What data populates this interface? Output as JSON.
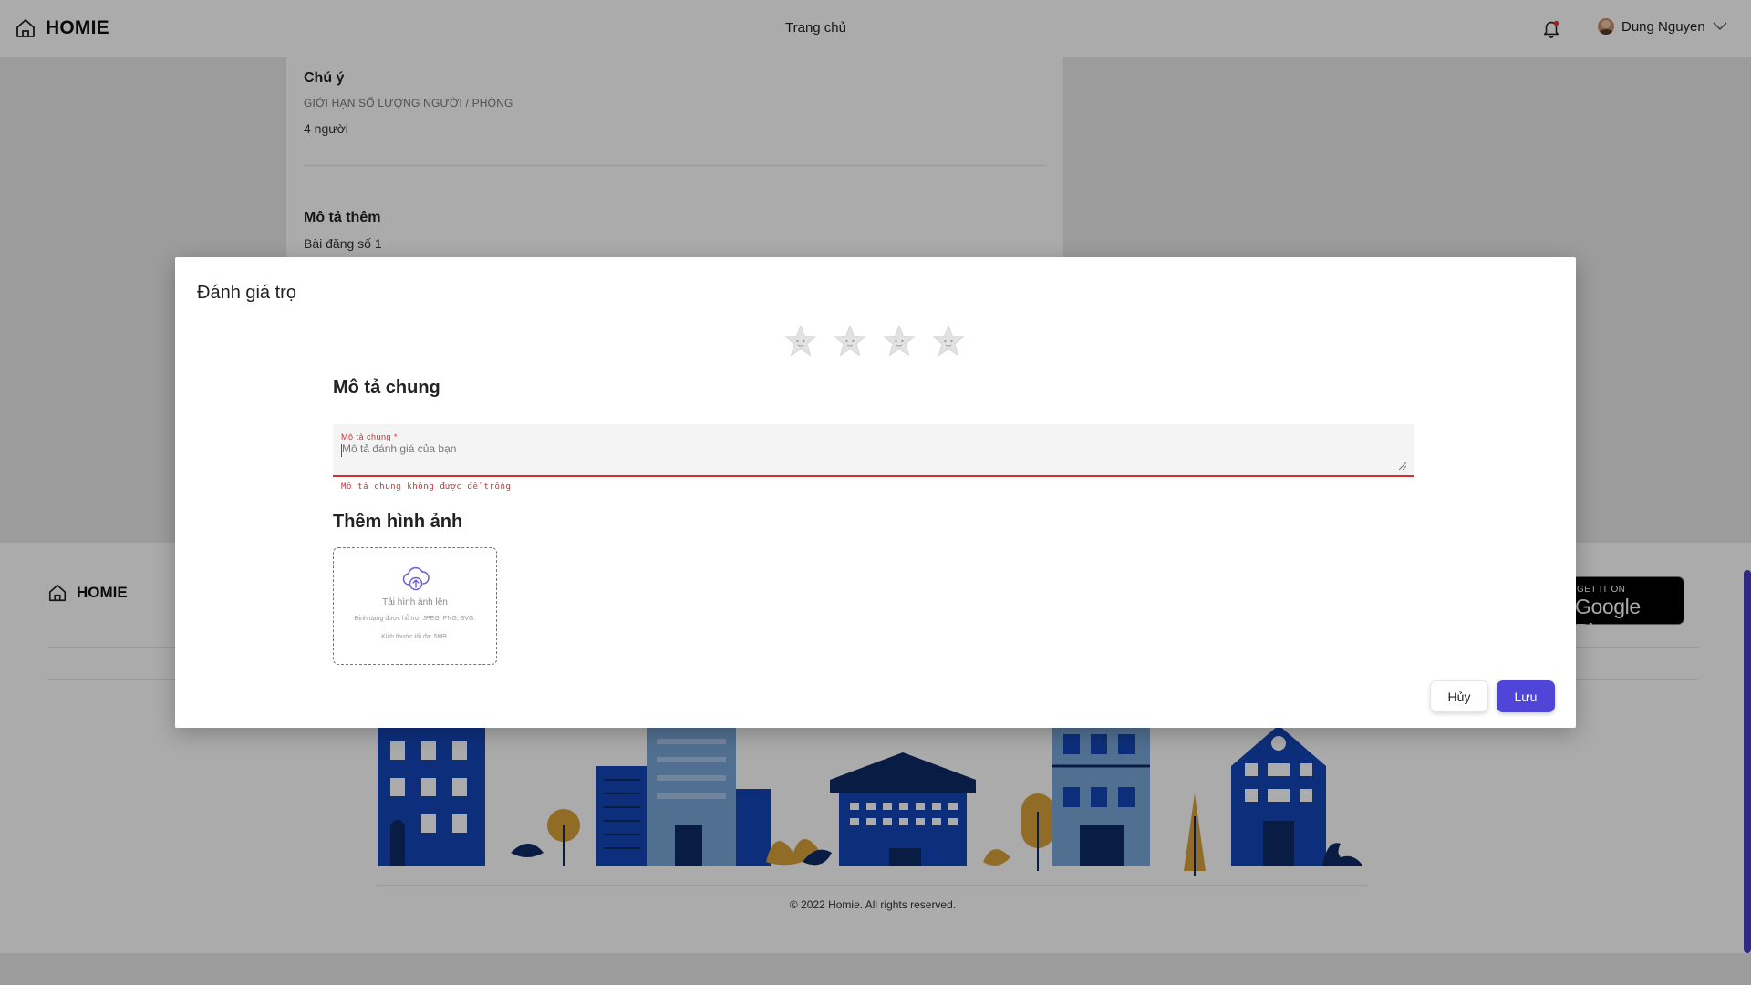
{
  "header": {
    "logo_text": "HOMIE",
    "nav_home": "Trang chủ",
    "user_name": "Dung Nguyen"
  },
  "listing": {
    "note_title": "Chú ý",
    "note_label": "GIỚI HẠN SỐ LƯỢNG NGƯỜI / PHÒNG",
    "note_value": "4 người",
    "extra_title": "Mô tả thêm",
    "extra_value": "Bài đăng số 1"
  },
  "footer": {
    "logo_text": "HOMIE",
    "store_small": "GET IT ON",
    "store_big": "Google Play",
    "copyright": "© 2022 Homie. All rights reserved."
  },
  "modal": {
    "title": "Đánh giá trọ",
    "rating": {
      "value": 0,
      "max": 4
    },
    "description_heading": "Mô tả chung",
    "description_field": {
      "label": "Mô tả chung *",
      "placeholder": "Mô tả đánh giá của bạn",
      "value": "",
      "error": "Mô tả chung không được để trống"
    },
    "images_heading": "Thêm hình ảnh",
    "upload": {
      "main": "Tải hình ảnh lên",
      "hint_formats": "Định dạng được hỗ trợ: JPEG, PNG, SVG.",
      "hint_size": "Kích thước tối đa: 5MB."
    },
    "cancel_label": "Hủy",
    "save_label": "Lưu"
  },
  "colors": {
    "accent": "#4f45d6",
    "error": "#d32f2f",
    "city_blue": "#1446b8",
    "city_navy": "#0e2a66",
    "city_gold": "#d9a23a",
    "city_light": "#7aa7d8"
  }
}
